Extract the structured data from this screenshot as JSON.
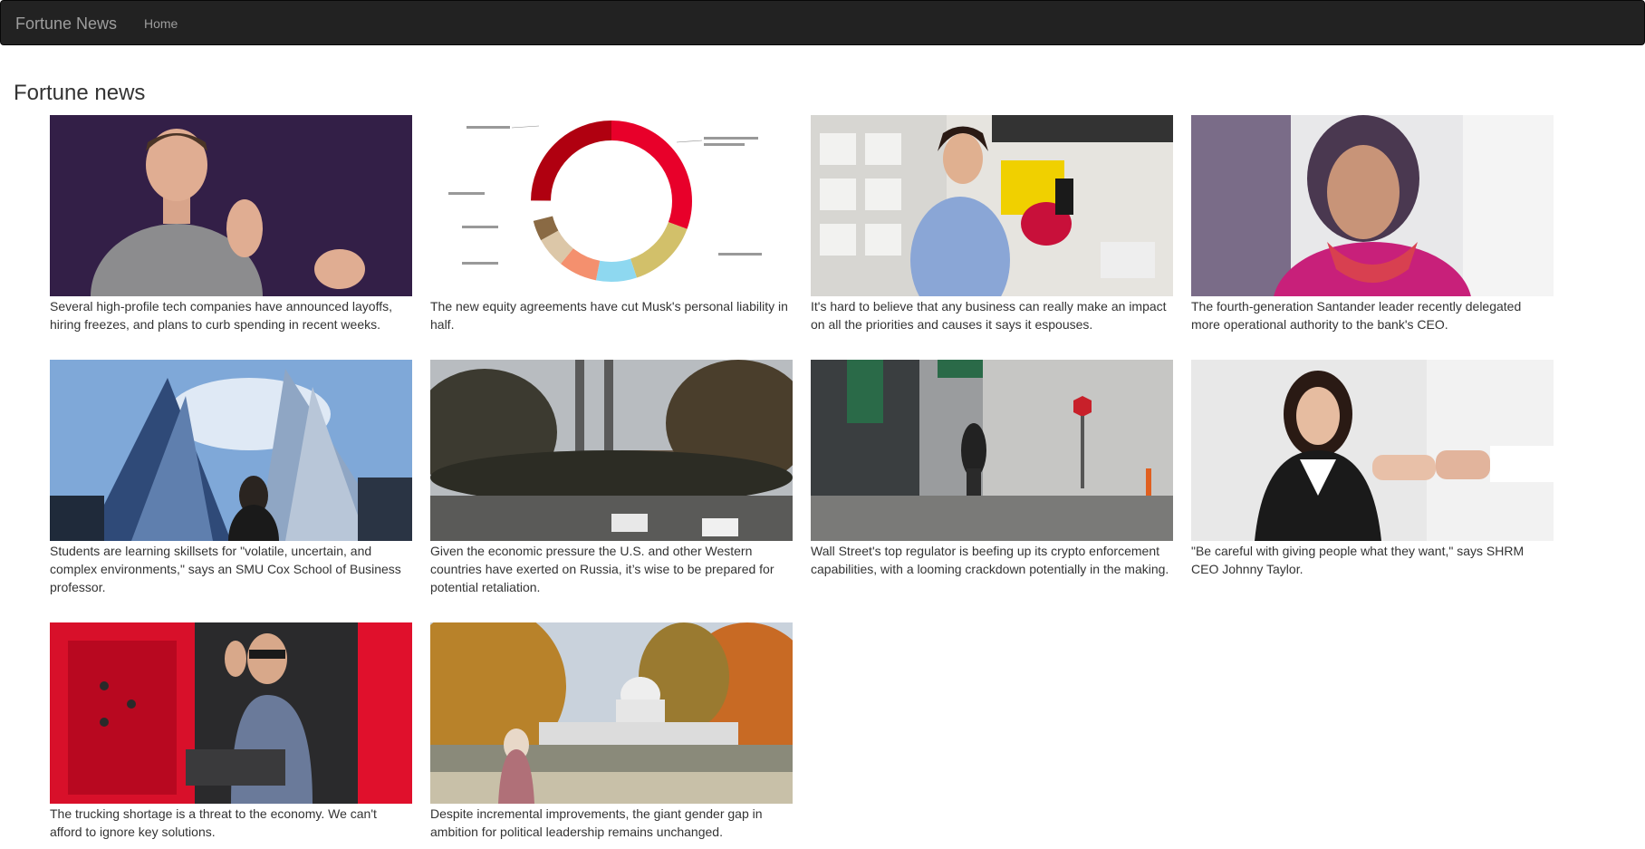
{
  "navbar": {
    "brand": "Fortune News",
    "home_label": "Home"
  },
  "page": {
    "title": "Fortune news"
  },
  "articles": [
    {
      "image": "person-speaking-on-stage-photo",
      "caption": "Several high-profile tech companies have announced layoffs, hiring freezes, and plans to curb spending in recent weeks."
    },
    {
      "image": "ownership-donut-chart-image",
      "caption": "The new equity agreements have cut Musk's personal liability in half."
    },
    {
      "image": "lab-researcher-photo",
      "caption": "It's hard to believe that any business can really make an impact on all the priorities and causes it says it espouses."
    },
    {
      "image": "executive-portrait-photo",
      "caption": "The fourth-generation Santander leader recently delegated more operational authority to the bank's CEO."
    },
    {
      "image": "skyscrapers-photo",
      "caption": "Students are learning skillsets for \"volatile, uncertain, and complex environments,\" says an SMU Cox School of Business professor."
    },
    {
      "image": "smokestacks-street-photo",
      "caption": "Given the economic pressure the U.S. and other Western countries have exerted on Russia, it’s wise to be prepared for potential retaliation."
    },
    {
      "image": "city-street-pedestrian-photo",
      "caption": "Wall Street's top regulator is beefing up its crypto enforcement capabilities, with a looming crackdown potentially in the making."
    },
    {
      "image": "business-handshake-photo",
      "caption": "\"Be careful with giving people what they want,\" says SHRM CEO Johnny Taylor."
    },
    {
      "image": "truck-driver-photo",
      "caption": "The trucking shortage is a threat to the economy. We can't afford to ignore key solutions."
    },
    {
      "image": "capitol-building-photo",
      "caption": "Despite incremental improvements, the giant gender gap in ambition for political leadership remains unchanged."
    }
  ],
  "colors": {
    "navbar_bg": "#222222",
    "navbar_text": "#9d9d9d",
    "body_text": "#333333"
  }
}
